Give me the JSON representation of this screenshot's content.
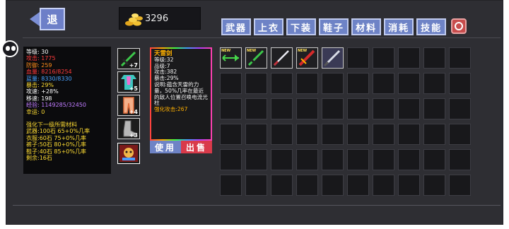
{
  "header": {
    "back_label": "退",
    "gold_amount": "3296"
  },
  "tabs": [
    "武器",
    "上衣",
    "下装",
    "鞋子",
    "材料",
    "消耗",
    "技能"
  ],
  "stats": [
    {
      "text": "等级: 30",
      "color": "#ffffff"
    },
    {
      "text": "攻击: 1775",
      "color": "#ff3b3b"
    },
    {
      "text": "防御: 259",
      "color": "#ff8c1a"
    },
    {
      "text": "血量: 8216/8254",
      "color": "#ff3b3b"
    },
    {
      "text": "蓝量: 8330/8330",
      "color": "#4aa3ff"
    },
    {
      "text": "暴击: 29%",
      "color": "#ffdd33"
    },
    {
      "text": "攻速: +28%",
      "color": "#ffffff"
    },
    {
      "text": "移速: 198",
      "color": "#ffffff"
    },
    {
      "text": "经验: 1149285/32450",
      "color": "#c07cff"
    },
    {
      "text": "幸运: 0",
      "color": "#ffdd33"
    },
    {
      "text": "",
      "color": "#ffffff"
    },
    {
      "text": "强化下一级所需材料",
      "color": "#ffdd33"
    },
    {
      "text": "武器:100石 65+0%几率",
      "color": "#ffdd33"
    },
    {
      "text": "衣服:60石 75+0%几率",
      "color": "#ffdd33"
    },
    {
      "text": "裤子:50石 80+0%几率",
      "color": "#ffdd33"
    },
    {
      "text": "鞋子:40石 85+0%几率",
      "color": "#ffdd33"
    },
    {
      "text": "剩余:16石",
      "color": "#ffdd33"
    }
  ],
  "equipment": [
    {
      "icon": "green-sword-icon",
      "plus": "+7"
    },
    {
      "icon": "armor-icon",
      "plus": "+5"
    },
    {
      "icon": "pants-icon",
      "plus": "+4"
    },
    {
      "icon": "boots-icon",
      "plus": "+3"
    },
    {
      "icon": "skill-icon",
      "plus": ""
    }
  ],
  "tooltip": {
    "title": "天雷剑",
    "lines": [
      "等级:32",
      "品级:7",
      "攻击:382",
      "暴击:29%",
      "说明:蕴含天雷的力量，50%几率在最近的敌人位置召唤电流光柱"
    ],
    "strengthen": "强化攻击:267"
  },
  "actions": {
    "use": "使用",
    "sell": "出售"
  },
  "inventory": [
    {
      "icon": "green-arrow-icon",
      "is_new": true
    },
    {
      "icon": "green-sword-icon",
      "is_new": true
    },
    {
      "icon": "lightning-sword-icon",
      "is_new": false
    },
    {
      "icon": "fire-sword-icon",
      "is_new": true
    },
    {
      "icon": "silver-sword-icon",
      "is_new": false
    }
  ],
  "new_tag": "NEW",
  "grid_size": 60,
  "colors": {
    "tab_bg": "#6e83c6",
    "use_btn": "#6e83c6",
    "sell_btn": "#d93a4a"
  }
}
